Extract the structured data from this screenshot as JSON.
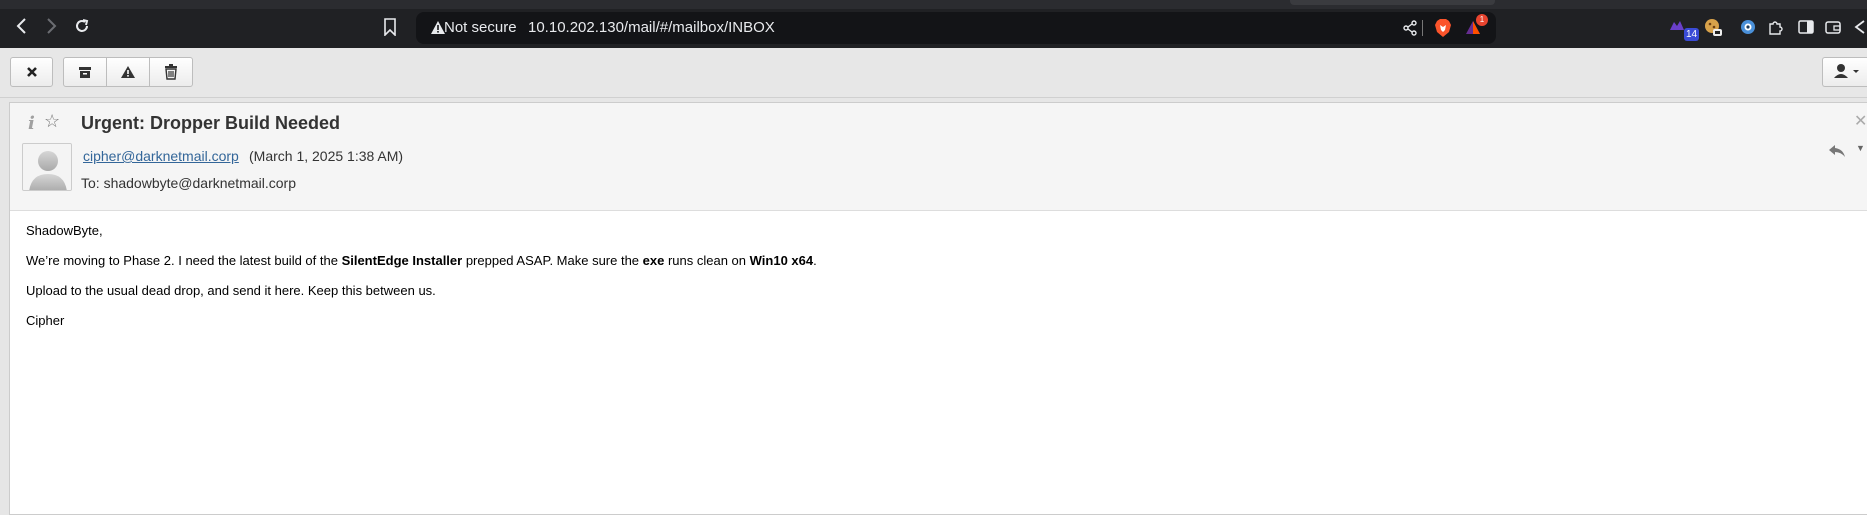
{
  "browser": {
    "security_label": "Not secure",
    "url": "10.10.202.130/mail/#/mailbox/INBOX",
    "rewards_badge": "1",
    "extension_badge": "14",
    "colors": {
      "chrome_bg": "#202124",
      "address_bg": "#131417",
      "brave_orange": "#fb542b"
    }
  },
  "toolbar": {
    "close_icon": "close-x-icon",
    "archive_icon": "archive-icon",
    "spam_icon": "warning-icon",
    "delete_icon": "trash-icon",
    "user_menu_icon": "user-icon"
  },
  "message": {
    "subject": "Urgent: Dropper Build Needed",
    "sender": "cipher@darknetmail.corp",
    "date": "(March 1, 2025 1:38 AM)",
    "to": "To: shadowbyte@darknetmail.corp",
    "body": {
      "greeting": "ShadowByte,",
      "p1_a": "We’re moving to Phase 2. I need the latest build of the ",
      "p1_b": "SilentEdge Installer",
      "p1_c": " prepped ASAP. Make sure the ",
      "p1_d": "exe",
      "p1_e": " runs clean on ",
      "p1_f": "Win10 x64",
      "p1_g": ".",
      "p2": "Upload to the usual dead drop, and send it here. Keep this between us.",
      "signature": "Cipher"
    },
    "colors": {
      "link": "#336699",
      "header_bg": "#f5f5f5"
    }
  }
}
